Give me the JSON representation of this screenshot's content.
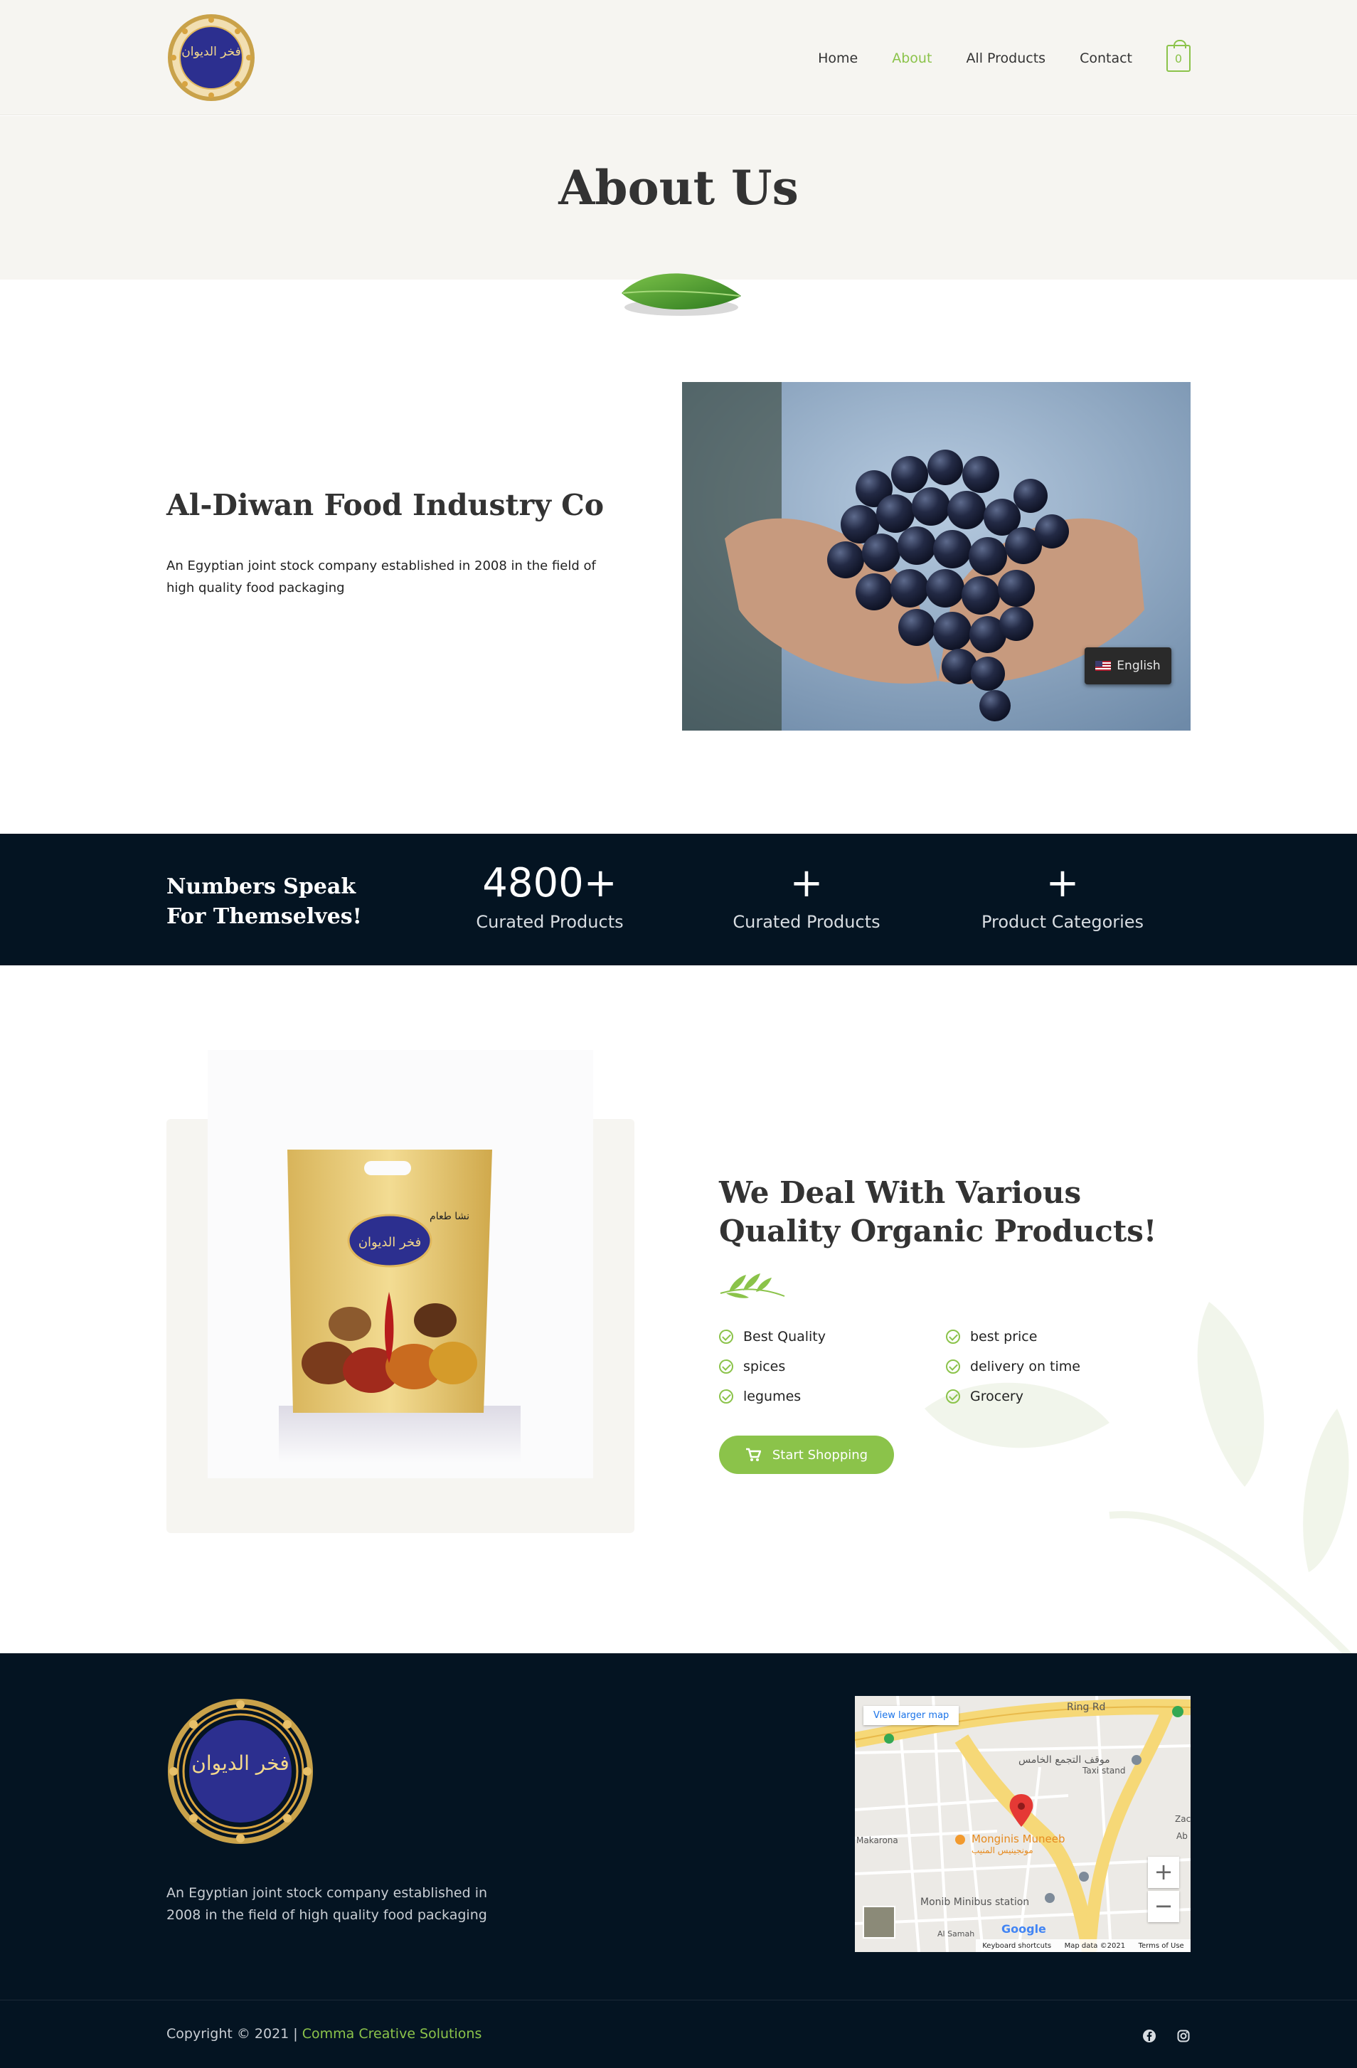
{
  "colors": {
    "accent": "#8bc34a",
    "dark": "#041422",
    "light_band": "#f6f5f1"
  },
  "logo": {
    "alt_text": "فخر الديوان"
  },
  "nav": {
    "items": [
      {
        "label": "Home"
      },
      {
        "label": "About"
      },
      {
        "label": "All Products"
      },
      {
        "label": "Contact"
      }
    ],
    "active": "About",
    "cart_count": "0"
  },
  "page_title": "About Us",
  "intro": {
    "title": "Al-Diwan Food Industry Co",
    "text": "An Egyptian joint stock company established in 2008 in the field of high quality food packaging",
    "language_label": "English"
  },
  "stats": {
    "title": "Numbers Speak For Themselves!",
    "items": [
      {
        "value": "4800+",
        "label": "Curated Products"
      },
      {
        "value": "+",
        "label": "Curated Products"
      },
      {
        "value": "+",
        "label": "Product Categories"
      }
    ]
  },
  "products": {
    "bag_text": "نشا طعام",
    "title": "We Deal With Various Quality Organic Products!",
    "features_left": [
      "Best Quality",
      "spices",
      "legumes"
    ],
    "features_right": [
      "best price",
      "delivery on time",
      "Grocery"
    ],
    "button_label": "Start Shopping"
  },
  "footer": {
    "text": "An Egyptian joint stock company established in 2008 in the field of high quality food packaging",
    "map": {
      "view_larger": "View larger map",
      "labels": {
        "ring_rd": "Ring Rd",
        "mawqif": "موقف التجمع الخامس",
        "taxi": "Taxi stand",
        "monginis": "Monginis Muneeb",
        "monginis_ar": "مونجينيس المنيب",
        "minibus": "Monib Minibus station",
        "makarona": "Makarona",
        "al_samah": "Al Samah",
        "ab": "Ab",
        "zac": "Zac"
      },
      "zoom_in": "+",
      "zoom_out": "−",
      "footer_items": [
        "Keyboard shortcuts",
        "Map data ©2021",
        "Terms of Use"
      ],
      "google": "Google"
    },
    "copyright": "Copyright © 2021 | ",
    "copyright_link": "Comma Creative Solutions"
  },
  "icons": [
    "cart-icon",
    "check-icon",
    "facebook-icon",
    "instagram-icon",
    "map-pin-icon"
  ]
}
